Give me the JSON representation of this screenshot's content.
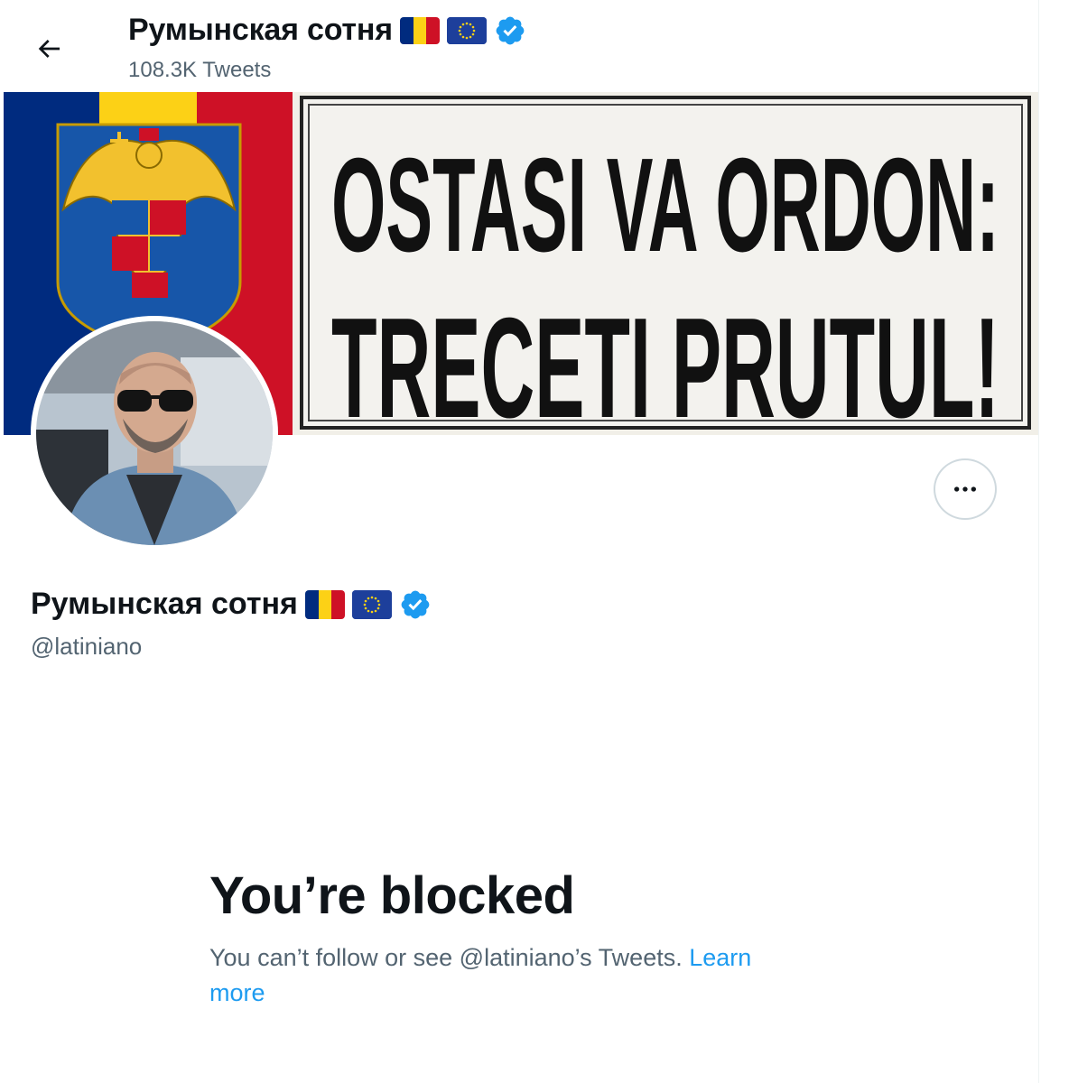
{
  "header": {
    "back_label": "Back",
    "title": "Румынская сотня",
    "tweet_count": "108.3K Tweets"
  },
  "banner": {
    "line1": "OSTASI VA ORDON:",
    "line2": "TRECETI PRUTUL!"
  },
  "profile": {
    "name": "Румынская сотня",
    "handle": "@latiniano",
    "verified": true
  },
  "blocked": {
    "title": "You’re blocked",
    "message": "You can’t follow or see @latiniano’s Tweets.",
    "learn_more": "Learn more"
  },
  "colors": {
    "accent": "#1d9bf0",
    "secondary_text": "#536471",
    "border": "#cfd9de",
    "romania_blue": "#002b7f",
    "romania_yellow": "#fcd116",
    "romania_red": "#ce1126",
    "eu_blue": "#1d3f9b"
  },
  "icons": [
    "arrow-left-icon",
    "verified-badge-icon",
    "more-horizontal-icon",
    "romania-flag-icon",
    "eu-flag-icon"
  ]
}
